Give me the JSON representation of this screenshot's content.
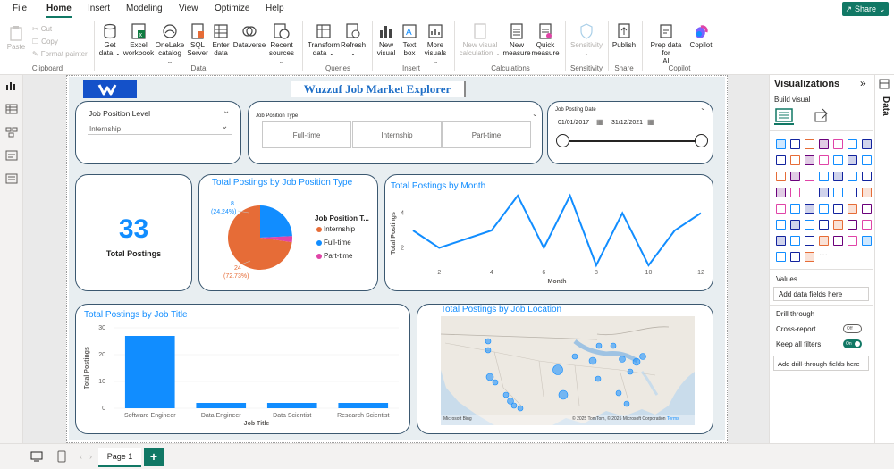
{
  "menu": {
    "items": [
      "File",
      "Home",
      "Insert",
      "Modeling",
      "View",
      "Optimize",
      "Help"
    ],
    "share": "Share"
  },
  "ribbon": {
    "clipboard": {
      "paste": "Paste",
      "cut": "Cut",
      "copy": "Copy",
      "format_painter": "Format painter",
      "group": "Clipboard"
    },
    "data": {
      "get_data": [
        "Get",
        "data ⌄"
      ],
      "excel": [
        "Excel",
        "workbook"
      ],
      "onelake": [
        "OneLake",
        "catalog ⌄"
      ],
      "sql": [
        "SQL",
        "Server"
      ],
      "enter": [
        "Enter",
        "data"
      ],
      "dataverse": [
        "Dataverse"
      ],
      "recent": [
        "Recent",
        "sources ⌄"
      ],
      "group": "Data"
    },
    "queries": {
      "transform": [
        "Transform",
        "data ⌄"
      ],
      "refresh": [
        "Refresh",
        "⌄"
      ],
      "group": "Queries"
    },
    "insert": {
      "new_visual": [
        "New",
        "visual"
      ],
      "text_box": [
        "Text",
        "box"
      ],
      "more_visuals": [
        "More",
        "visuals ⌄"
      ],
      "group": "Insert"
    },
    "calculations": {
      "new_visual_calc": [
        "New visual",
        "calculation ⌄"
      ],
      "new_measure": [
        "New",
        "measure"
      ],
      "quick_measure": [
        "Quick",
        "measure"
      ],
      "group": "Calculations"
    },
    "sensitivity": {
      "label": [
        "Sensitivity",
        "⌄"
      ],
      "group": "Sensitivity"
    },
    "share": {
      "publish": [
        "Publish"
      ],
      "group": "Share"
    },
    "copilot": {
      "prep": [
        "Prep data for",
        "AI"
      ],
      "copilot": [
        "Copilot"
      ],
      "group": "Copilot"
    }
  },
  "report": {
    "title": "Wuzzuf Job Market Explorer",
    "slicer_level": {
      "title": "Job Position Level",
      "value": "Internship"
    },
    "slicer_type": {
      "title": "Job Position Type",
      "options": [
        "Full-time",
        "Internship",
        "Part-time"
      ]
    },
    "slicer_date": {
      "title": "Job Posting Date",
      "start": "01/01/2017",
      "end": "31/12/2021"
    },
    "kpi": {
      "value": "33",
      "label": "Total Postings"
    },
    "pie": {
      "title": "Total Postings by Job Position Type",
      "legend_title": "Job Position T...",
      "legend": [
        "Internship",
        "Full-time",
        "Part-time"
      ],
      "label_top": [
        "8",
        "(24.24%)"
      ],
      "label_bottom": [
        "24",
        "(72.73%)"
      ]
    },
    "line": {
      "title": "Total Postings by Month",
      "ylabel": "Total Postings",
      "xlabel": "Month"
    },
    "bar": {
      "title": "Total Postings by Job Title",
      "ylabel": "Total Postings",
      "xlabel": "Job Title"
    },
    "map": {
      "title": "Total Postings by Job Location",
      "credit_left": "Microsoft Bing",
      "credit_right": "© 2025 TomTom, © 2025 Microsoft Corporation",
      "terms": "Terms"
    }
  },
  "chart_data": [
    {
      "type": "pie",
      "title": "Total Postings by Job Position Type",
      "categories": [
        "Internship",
        "Full-time",
        "Part-time"
      ],
      "values": [
        24,
        8,
        1
      ],
      "colors": [
        "#e66c37",
        "#118dff",
        "#e044a7"
      ]
    },
    {
      "type": "line",
      "title": "Total Postings by Month",
      "xlabel": "Month",
      "ylabel": "Total Postings",
      "x": [
        1,
        2,
        3,
        4,
        5,
        6,
        7,
        8,
        9,
        10,
        11,
        12
      ],
      "y": [
        3,
        2,
        null,
        3,
        5,
        2,
        5,
        1,
        4,
        1,
        3,
        4
      ],
      "x_observed": [
        1,
        2,
        4,
        5,
        6,
        7,
        8,
        9,
        10,
        11,
        12
      ],
      "y_observed": [
        3,
        2,
        3,
        5,
        2,
        5,
        1,
        4,
        1,
        3,
        4
      ],
      "xticks": [
        2,
        4,
        6,
        8,
        10,
        12
      ],
      "yticks": [
        2,
        4
      ],
      "ylim": [
        1,
        5
      ]
    },
    {
      "type": "bar",
      "title": "Total Postings by Job Title",
      "xlabel": "Job Title",
      "ylabel": "Total Postings",
      "categories": [
        "Software Engineer",
        "Data Engineer",
        "Data Scientist",
        "Research Scientist"
      ],
      "values": [
        27,
        2,
        2,
        2
      ],
      "yticks": [
        0,
        10,
        20,
        30
      ],
      "ylim": [
        0,
        30
      ]
    }
  ],
  "viz": {
    "title": "Visualizations",
    "build": "Build visual",
    "values": "Values",
    "add_fields": "Add data fields here",
    "drill": "Drill through",
    "cross_report": "Cross-report",
    "cross_state": "Off",
    "keep_filters": "Keep all filters",
    "keep_state": "On",
    "add_drill": "Add drill-through fields here",
    "data_tab": "Data"
  },
  "pages": {
    "current": "Page 1",
    "add": "+"
  },
  "colors": {
    "accent": "#117865",
    "pbi_blue": "#118dff",
    "orange": "#e66c37",
    "pink": "#e044a7",
    "border": "#3b5870"
  }
}
